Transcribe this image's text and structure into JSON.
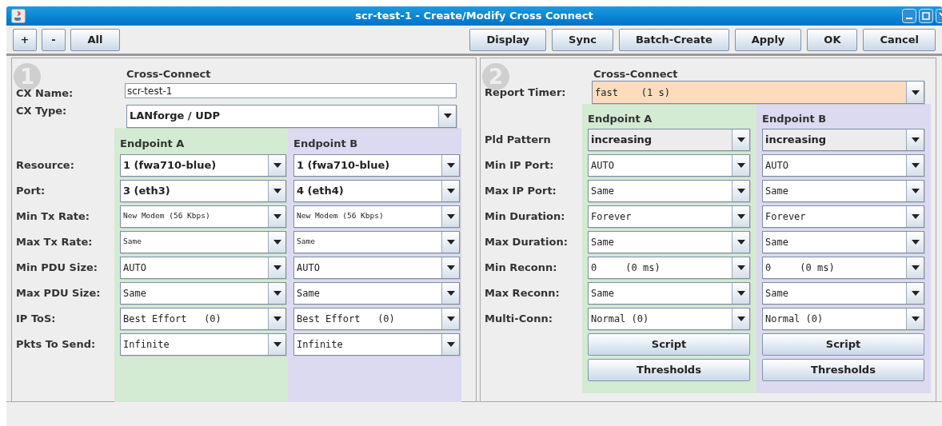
{
  "window": {
    "title": "scr-test-1 - Create/Modify Cross Connect"
  },
  "toolbar": {
    "left_buttons": [
      "+",
      "-",
      "All"
    ],
    "right_buttons": [
      "Display",
      "Sync",
      "Batch-Create",
      "Apply",
      "OK",
      "Cancel"
    ]
  },
  "left_panel": {
    "badge": "1",
    "heading": "Cross-Connect",
    "cx_name": {
      "label": "CX Name:",
      "value": "scr-test-1"
    },
    "cx_type": {
      "label": "CX Type:",
      "value": "LANforge / UDP",
      "kind": "choice"
    },
    "endpoint_headers": [
      "Endpoint A",
      "Endpoint B"
    ],
    "rows": [
      {
        "label": "Resource:",
        "kind": "choice",
        "values": [
          "1 (fwa710-blue)",
          "1 (fwa710-blue)"
        ]
      },
      {
        "label": "Port:",
        "kind": "choice",
        "values": [
          "3 (eth3)",
          "4 (eth4)"
        ]
      },
      {
        "label": "Min Tx Rate:",
        "kind": "rate",
        "values": [
          "New Modem (56 Kbps)",
          "New Modem (56 Kbps)"
        ]
      },
      {
        "label": "Max Tx Rate:",
        "kind": "rate",
        "values": [
          "Same",
          "Same"
        ]
      },
      {
        "label": "Min PDU Size:",
        "kind": "editable",
        "values": [
          "AUTO",
          "AUTO"
        ]
      },
      {
        "label": "Max PDU Size:",
        "kind": "editable",
        "values": [
          "Same",
          "Same"
        ]
      },
      {
        "label": "IP ToS:",
        "kind": "editable",
        "values": [
          "Best Effort   (0)",
          "Best Effort   (0)"
        ]
      },
      {
        "label": "Pkts To Send:",
        "kind": "editable",
        "values": [
          "Infinite",
          "Infinite"
        ]
      }
    ]
  },
  "right_panel": {
    "badge": "2",
    "heading": "Cross-Connect",
    "report_timer": {
      "label": "Report Timer:",
      "value": "fast    (1 s)",
      "kind": "editable",
      "highlighted": true
    },
    "endpoint_headers": [
      "Endpoint A",
      "Endpoint B"
    ],
    "rows": [
      {
        "label": "Pld Pattern",
        "kind": "readonly",
        "values": [
          "increasing",
          "increasing"
        ]
      },
      {
        "label": "Min IP Port:",
        "kind": "editable",
        "values": [
          "AUTO",
          "AUTO"
        ]
      },
      {
        "label": "Max IP Port:",
        "kind": "editable",
        "values": [
          "Same",
          "Same"
        ]
      },
      {
        "label": "Min Duration:",
        "kind": "editable",
        "values": [
          "Forever",
          "Forever"
        ]
      },
      {
        "label": "Max Duration:",
        "kind": "editable",
        "values": [
          "Same",
          "Same"
        ]
      },
      {
        "label": "Min Reconn:",
        "kind": "editable",
        "values": [
          "0     (0 ms)",
          "0     (0 ms)"
        ]
      },
      {
        "label": "Max Reconn:",
        "kind": "editable",
        "values": [
          "Same",
          "Same"
        ]
      },
      {
        "label": "Multi-Conn:",
        "kind": "editable",
        "values": [
          "Normal (0)",
          "Normal (0)"
        ]
      }
    ],
    "buttons": [
      [
        "Script",
        "Script"
      ],
      [
        "Thresholds",
        "Thresholds"
      ]
    ]
  }
}
